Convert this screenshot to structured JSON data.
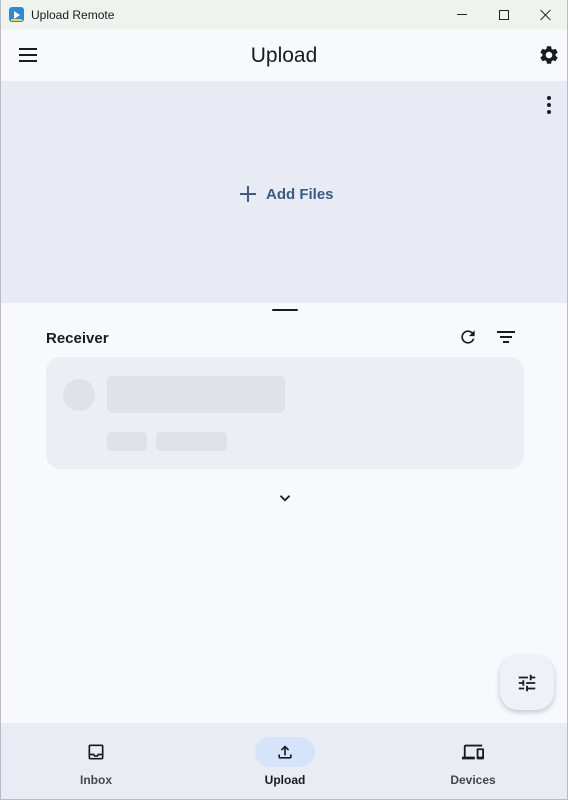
{
  "window": {
    "title": "Upload Remote",
    "icons": {
      "app": "app-logo-icon",
      "minimize": "minimize-icon",
      "maximize": "maximize-icon",
      "close": "close-icon"
    }
  },
  "appbar": {
    "title": "Upload",
    "icons": {
      "menu": "menu-icon",
      "settings": "gear-icon"
    }
  },
  "dropzone": {
    "add_files_label": "Add Files",
    "icons": {
      "add": "plus-icon",
      "more": "more-vert-icon"
    }
  },
  "receiver": {
    "label": "Receiver",
    "icons": {
      "refresh": "refresh-icon",
      "filter": "filter-icon",
      "expand": "chevron-down-icon"
    },
    "loading": true
  },
  "fab": {
    "icon": "tune-icon"
  },
  "bottom_nav": {
    "items": [
      {
        "label": "Inbox",
        "icon": "inbox-icon",
        "selected": false
      },
      {
        "label": "Upload",
        "icon": "upload-icon",
        "selected": true
      },
      {
        "label": "Devices",
        "icon": "devices-icon",
        "selected": false
      }
    ]
  },
  "colors": {
    "accent": "#3a5c86",
    "selected_pill": "#d5e3fb",
    "dropzone_bg": "#e8ebf4",
    "surface": "#f8f9fd"
  }
}
